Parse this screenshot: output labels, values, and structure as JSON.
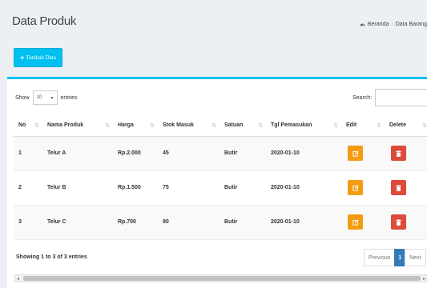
{
  "header": {
    "title": "Data Produk",
    "breadcrumb_home": "Beranda",
    "breadcrumb_sep": "›",
    "breadcrumb_current": "Data Barang"
  },
  "toolbar": {
    "add_label": "Tambah Data",
    "add_icon": "+"
  },
  "length": {
    "show": "Show",
    "value": "10",
    "entries": "entries"
  },
  "search": {
    "label": "Search:",
    "value": ""
  },
  "table": {
    "headers": [
      "No",
      "Nama Produk",
      "Harga",
      "Stok Masuk",
      "Satuan",
      "Tgl Pemasukan",
      "Edit",
      "Delete"
    ],
    "rows": [
      [
        "1",
        "Telur A",
        "Rp.2.000",
        "45",
        "Butir",
        "2020-01-10"
      ],
      [
        "2",
        "Telur B",
        "Rp.1.500",
        "75",
        "Butir",
        "2020-01-10"
      ],
      [
        "3",
        "Telur C",
        "Rp.700",
        "90",
        "Butir",
        "2020-01-10"
      ]
    ]
  },
  "footer": {
    "info": "Showing 1 to 3 of 3 entries",
    "prev": "Previous",
    "page": "1",
    "next": "Next"
  },
  "colors": {
    "accent": "#00c0ef",
    "edit": "#f39c12",
    "delete": "#dd4b39",
    "page_active": "#337ab7"
  }
}
